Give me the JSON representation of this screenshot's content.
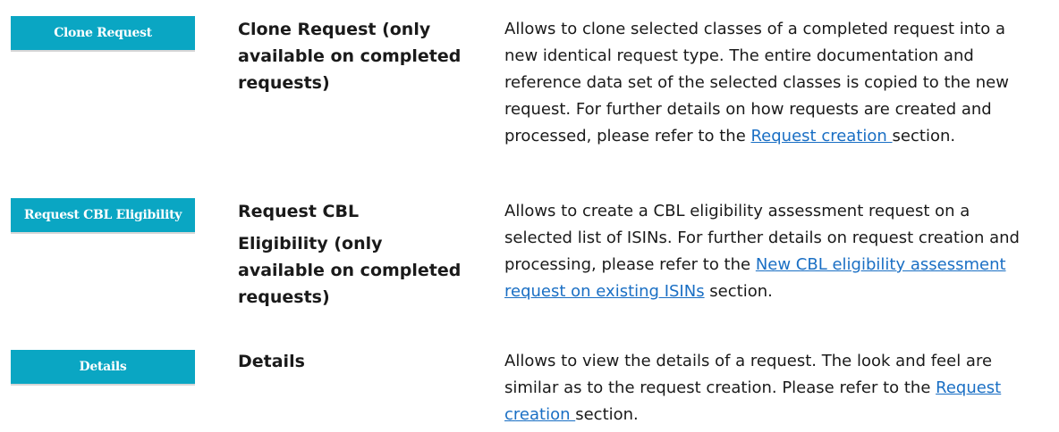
{
  "rows": [
    {
      "button_label": "Clone Request",
      "name_lines": [
        "Clone Request (only available on completed requests)"
      ],
      "description": {
        "before": "Allows to clone selected classes of a completed request into a new identical request type. The entire documentation and reference data set of the selected classes is copied to the new request. For further details on how requests are created and processed, please refer to the ",
        "link": "Request creation ",
        "after": "section."
      }
    },
    {
      "button_label": "Request CBL Eligibility",
      "name_lines": [
        "Request CBL",
        "Eligibility (only available on completed requests)"
      ],
      "description": {
        "before": "Allows to create a CBL eligibility assessment request on a selected list of ISINs. For further details on request creation and processing, please refer to the ",
        "link": "New CBL eligibility assessment request on existing ISINs",
        "after": " section."
      }
    },
    {
      "button_label": "Details",
      "name_lines": [
        "Details"
      ],
      "description": {
        "before": "Allows to view the details of a request. The look and feel are similar as to the request creation. Please refer to the ",
        "link": "Request creation ",
        "after": "section."
      }
    }
  ]
}
